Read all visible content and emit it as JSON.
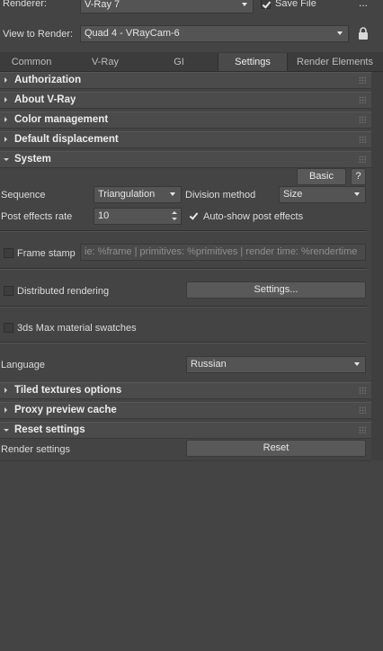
{
  "header": {
    "renderer_label": "Renderer:",
    "renderer_value": "V-Ray 7",
    "save_file_label": "Save File",
    "more_label": "...",
    "view_label": "View to Render:",
    "view_value": "Quad 4 - VRayCam-6"
  },
  "tabs": [
    "Common",
    "V-Ray",
    "GI",
    "Settings",
    "Render Elements"
  ],
  "active_tab": "Settings",
  "rollouts": {
    "authorization": "Authorization",
    "about": "About V-Ray",
    "color_management": "Color management",
    "default_displacement": "Default displacement",
    "system": "System",
    "tiled_textures": "Tiled textures options",
    "proxy_preview": "Proxy preview cache",
    "reset_settings": "Reset settings"
  },
  "system": {
    "basic_button": "Basic",
    "help_button": "?",
    "sequence_label": "Sequence",
    "sequence_value": "Triangulation",
    "division_label": "Division method",
    "division_value": "Size",
    "post_effects_label": "Post effects rate",
    "post_effects_value": "10",
    "auto_show_label": "Auto-show post effects",
    "frame_stamp_label": "Frame stamp",
    "frame_stamp_text": "ie: %frame | primitives: %primitives | render time: %rendertime",
    "distributed_label": "Distributed rendering",
    "distributed_settings_button": "Settings...",
    "swatches_label": "3ds Max material swatches",
    "language_label": "Language",
    "language_value": "Russian"
  },
  "reset": {
    "render_settings_label": "Render settings",
    "reset_button": "Reset"
  },
  "colors": {
    "background": "#444444",
    "rollout_header": "#4b4b4b",
    "control": "#545454",
    "text": "#e0e0e0"
  }
}
